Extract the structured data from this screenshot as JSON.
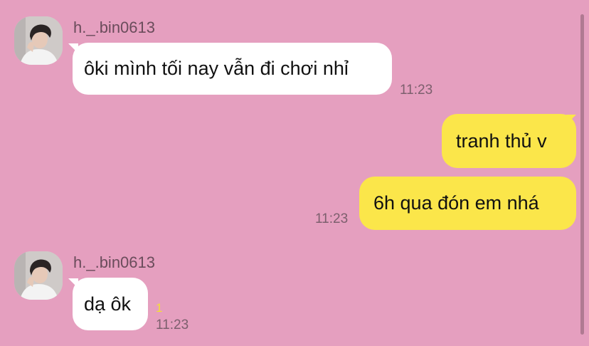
{
  "chat": {
    "contact_name": "h._.bin0613",
    "avatar_icon": "profile-photo",
    "colors": {
      "background": "#e59fbf",
      "incoming_bubble": "#ffffff",
      "outgoing_bubble": "#fbe64a",
      "unread": "#f4df34"
    },
    "messages": [
      {
        "direction": "incoming",
        "sender": "h._.bin0613",
        "text": "ôki mình tối nay vẫn đi chơi nhỉ",
        "time": "11:23"
      },
      {
        "direction": "outgoing",
        "text": "tranh thủ v"
      },
      {
        "direction": "outgoing",
        "text": "6h qua đón em nhá",
        "time": "11:23"
      },
      {
        "direction": "incoming",
        "sender": "h._.bin0613",
        "text": "dạ ôk",
        "unread_count": "1",
        "time": "11:23"
      }
    ]
  }
}
